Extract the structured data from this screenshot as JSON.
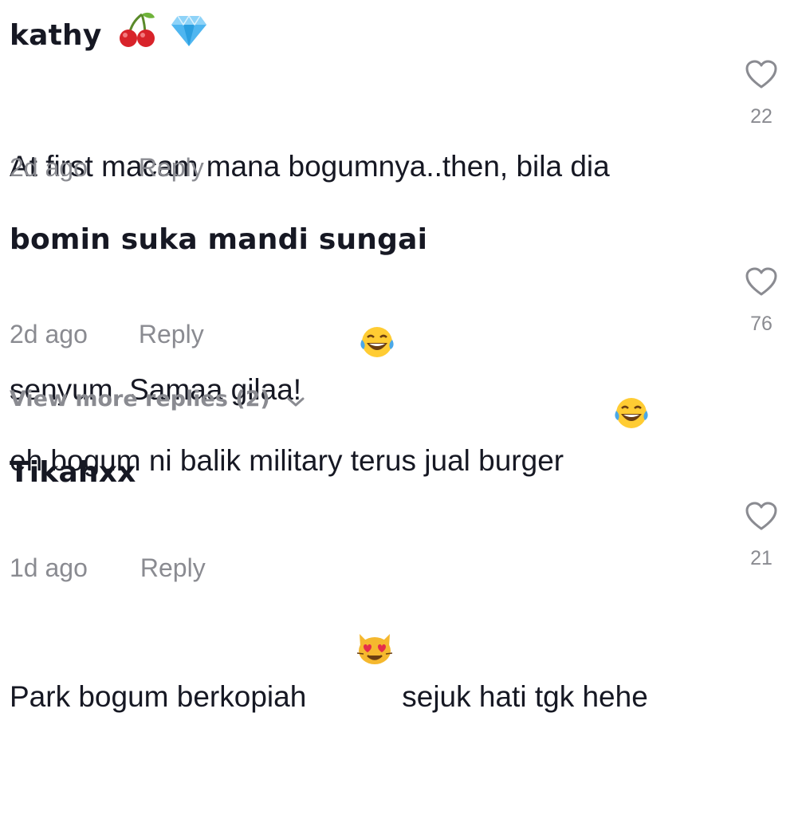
{
  "comments": [
    {
      "username": "kathy",
      "badges": [
        "cherry-icon",
        "diamond-icon"
      ],
      "text_line1": "At first macam mana bogumnya..then, bila dia",
      "text_line2": "senyum. Samaa gilaa!",
      "text_emoji": "face-with-tears-of-joy-icon",
      "time": "2d ago",
      "reply_label": "Reply",
      "likes": "22"
    },
    {
      "username": "bomin suka mandi sungai",
      "text_line1": "eh bogum ni balik military terus jual burger",
      "text_emoji": "face-with-tears-of-joy-icon",
      "time": "2d ago",
      "reply_label": "Reply",
      "likes": "76"
    },
    {
      "username": "Tikahxx",
      "text_before_emoji": "Park bogum berkopiah",
      "text_after_emoji": " sejuk hati tgk hehe",
      "text_emoji": "heart-eyes-cat-icon",
      "time": "1d ago",
      "reply_label": "Reply",
      "likes": "21"
    }
  ],
  "view_more": {
    "label": "View more replies (2)",
    "icon": "chevron-down-icon"
  },
  "colors": {
    "primary_text": "#161823",
    "secondary_text": "#8a8b91",
    "background": "#ffffff"
  }
}
